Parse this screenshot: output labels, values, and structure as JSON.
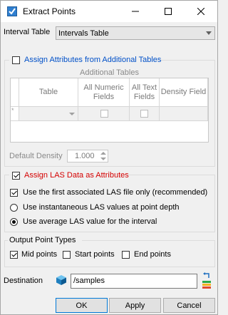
{
  "window": {
    "title": "Extract Points"
  },
  "interval_table": {
    "label": "Interval Table",
    "value": "Intervals Table"
  },
  "assign_additional": {
    "label": "Assign Attributes from Additional Tables",
    "checked": false
  },
  "additional_tables": {
    "caption": "Additional Tables",
    "columns": [
      "Table",
      "All Numeric Fields",
      "All Text Fields",
      "Density Field"
    ],
    "row_marker": "*"
  },
  "default_density": {
    "label": "Default Density",
    "value": "1.000"
  },
  "assign_las": {
    "label": "Assign LAS Data as Attributes",
    "checked": true
  },
  "las_options": {
    "first_file_only": {
      "label": "Use the first associated LAS file only (recommended)",
      "checked": true
    },
    "instantaneous": {
      "label": "Use instantaneous LAS values at point depth",
      "selected": false
    },
    "average": {
      "label": "Use average LAS value for the interval",
      "selected": true
    }
  },
  "output_types": {
    "title": "Output Point Types",
    "mid": {
      "label": "Mid points",
      "checked": true
    },
    "start": {
      "label": "Start points",
      "checked": false
    },
    "end": {
      "label": "End points",
      "checked": false
    }
  },
  "destination": {
    "label": "Destination",
    "value": "/samples"
  },
  "buttons": {
    "ok": "OK",
    "apply": "Apply",
    "cancel": "Cancel"
  },
  "colors": {
    "link_blue": "#0050c8",
    "las_red": "#d40000",
    "accent": "#0078d7"
  }
}
